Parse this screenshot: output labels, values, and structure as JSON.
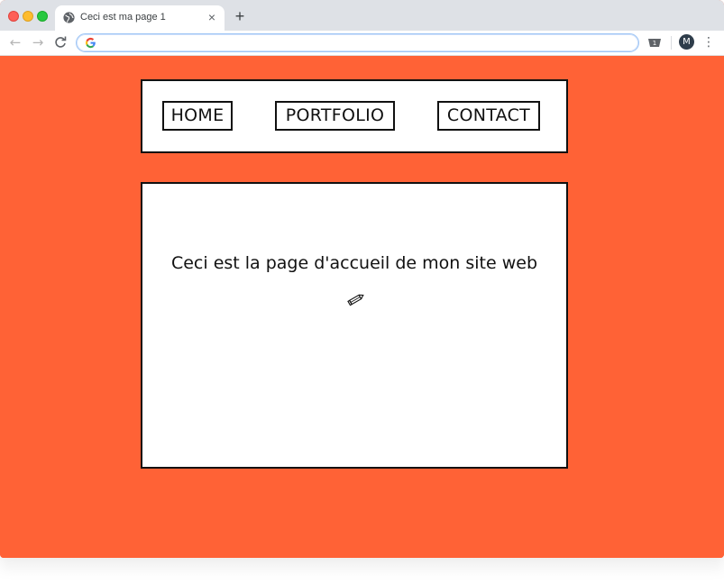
{
  "browser": {
    "tab_title": "Ceci est ma page 1",
    "tab_close_glyph": "×",
    "new_tab_glyph": "+",
    "address_value": "",
    "avatar_initial": "M",
    "icons": {
      "back": "arrow-left-icon",
      "forward": "arrow-right-icon",
      "reload": "reload-icon",
      "favicon": "globe-icon",
      "search_engine": "google-g-icon",
      "extension": "extension-icon",
      "menu": "three-dots-menu-icon"
    }
  },
  "site": {
    "nav": [
      {
        "label": "HOME"
      },
      {
        "label": "PORTFOLIO"
      },
      {
        "label": "CONTACT"
      }
    ],
    "heading": "Ceci est la page d'accueil de mon site web",
    "decoration_icon": "pencil-icon"
  },
  "colors": {
    "page_background": "#ff6236",
    "panel_background": "#ffffff",
    "border": "#111111",
    "tabstrip": "#dee1e6"
  }
}
